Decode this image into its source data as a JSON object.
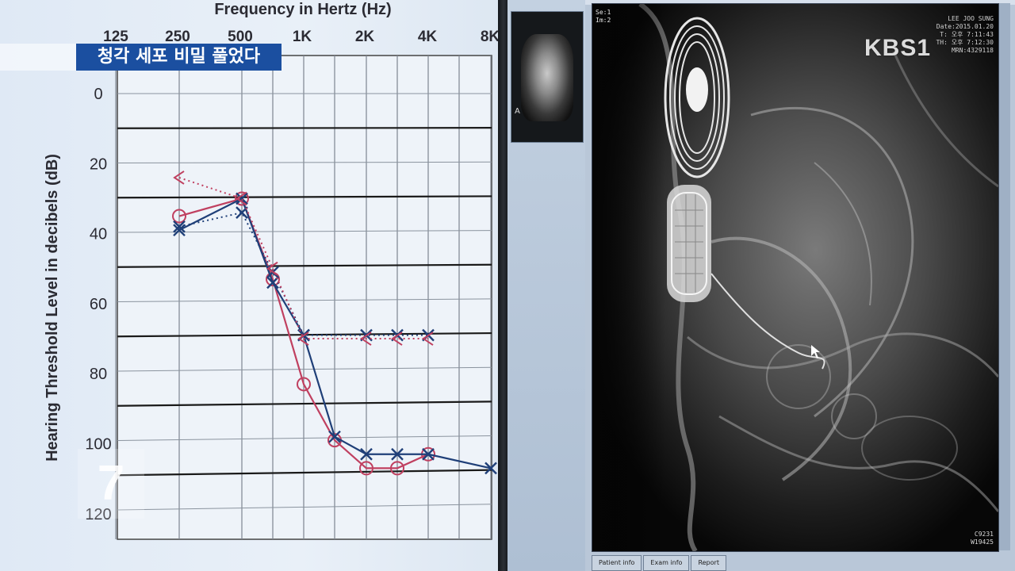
{
  "broadcast": {
    "caption": "청각 세포 비밀 풀었다",
    "logo": "KBS1",
    "channel_number": "7"
  },
  "audiogram": {
    "title": "Frequency in Hertz (Hz)",
    "y_axis_title": "Hearing Threshold Level in decibels (dB)",
    "frequency_labels": [
      "125",
      "250",
      "500",
      "1K",
      "2K",
      "4K",
      "8K"
    ],
    "db_labels": [
      "0",
      "20",
      "40",
      "60",
      "80",
      "100",
      "120"
    ]
  },
  "chart_data": {
    "type": "line",
    "xlabel": "Frequency in Hertz (Hz)",
    "ylabel": "Hearing Threshold Level in decibels (dB)",
    "categories": [
      "125",
      "250",
      "500",
      "1K",
      "2K",
      "4K",
      "8K"
    ],
    "x_positions": [
      125,
      250,
      500,
      750,
      1000,
      1500,
      2000,
      3000,
      4000,
      6000,
      8000
    ],
    "ylim": [
      0,
      120
    ],
    "y_inverted": true,
    "grid": true,
    "series": [
      {
        "color": "#c04060",
        "marker": "circle",
        "x": [
          250,
          500,
          750,
          1000,
          1500,
          2000,
          3000,
          4000
        ],
        "y": [
          35,
          30,
          53,
          83,
          99,
          107,
          107,
          103
        ]
      },
      {
        "color": "#1f3f78",
        "marker": "x",
        "x": [
          250,
          500,
          750,
          1000,
          1500,
          2000,
          3000,
          4000,
          8000
        ],
        "y": [
          39,
          30,
          54,
          69,
          98,
          103,
          103,
          103,
          107
        ]
      },
      {
        "color": "#1f3f78",
        "marker": "x-dotted",
        "style": "dotted",
        "x": [
          250,
          500,
          750,
          1000,
          2000,
          3000,
          4000
        ],
        "y": [
          38,
          34,
          51,
          69,
          69,
          69,
          69
        ]
      },
      {
        "color": "#c04060",
        "marker": "angle",
        "style": "dotted",
        "x": [
          250,
          500,
          750,
          1000,
          2000,
          3000,
          4000
        ],
        "y": [
          24,
          30,
          50,
          70,
          70,
          70,
          70
        ]
      }
    ]
  },
  "viewer": {
    "thumbnail_marker": "A",
    "overlay_top_left": "Se:1\nIm:2",
    "overlay_top_right": [
      "LEE JOO SUNG",
      "Date:2015.01.20",
      "T: 오후 7:11:43",
      "TH: 오후 7:12:30",
      "MRN:4329118"
    ],
    "overlay_bottom_right": [
      "C9231",
      "W19425"
    ],
    "tabs": [
      "Patient info",
      "Exam info",
      "Report"
    ]
  }
}
